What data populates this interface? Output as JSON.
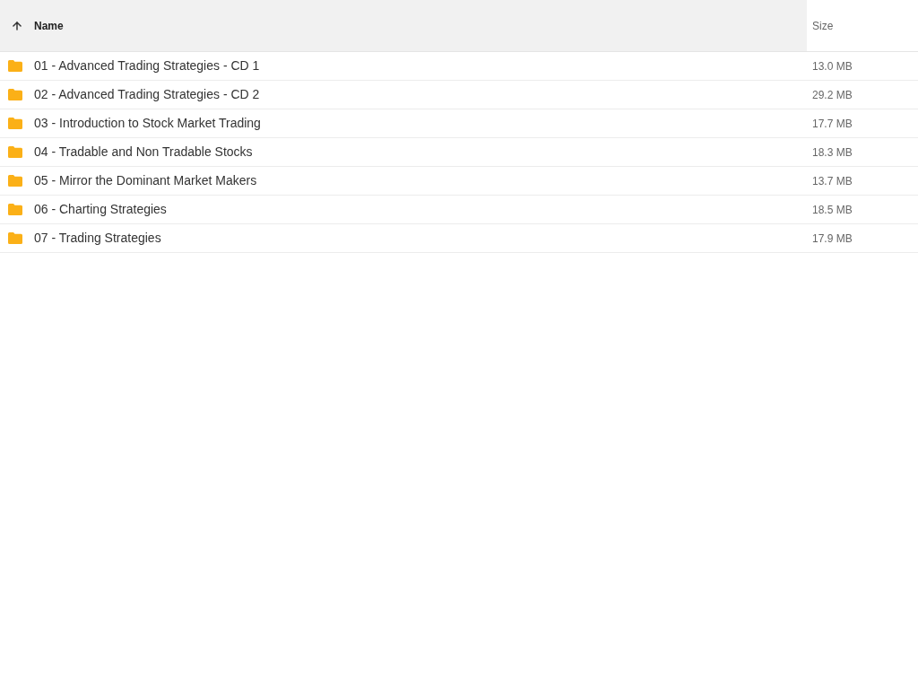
{
  "table": {
    "columns": [
      {
        "label": "Name",
        "sorted": true,
        "highlighted": true
      },
      {
        "label": "Size",
        "sorted": false,
        "highlighted": false
      }
    ],
    "rows": [
      {
        "kind": "folder",
        "name": "01 - Advanced Trading Strategies - CD 1",
        "size": "13.0 MB"
      },
      {
        "kind": "folder",
        "name": "02 - Advanced Trading Strategies - CD 2",
        "size": "29.2 MB"
      },
      {
        "kind": "folder",
        "name": "03 - Introduction to Stock Market Trading",
        "size": "17.7 MB"
      },
      {
        "kind": "folder",
        "name": "04 - Tradable and Non Tradable Stocks",
        "size": "18.3 MB"
      },
      {
        "kind": "folder",
        "name": "05 - Mirror the Dominant Market Makers",
        "size": "13.7 MB"
      },
      {
        "kind": "folder",
        "name": "06 - Charting Strategies",
        "size": "18.5 MB"
      },
      {
        "kind": "folder",
        "name": "07 - Trading Strategies",
        "size": "17.9 MB"
      }
    ]
  }
}
